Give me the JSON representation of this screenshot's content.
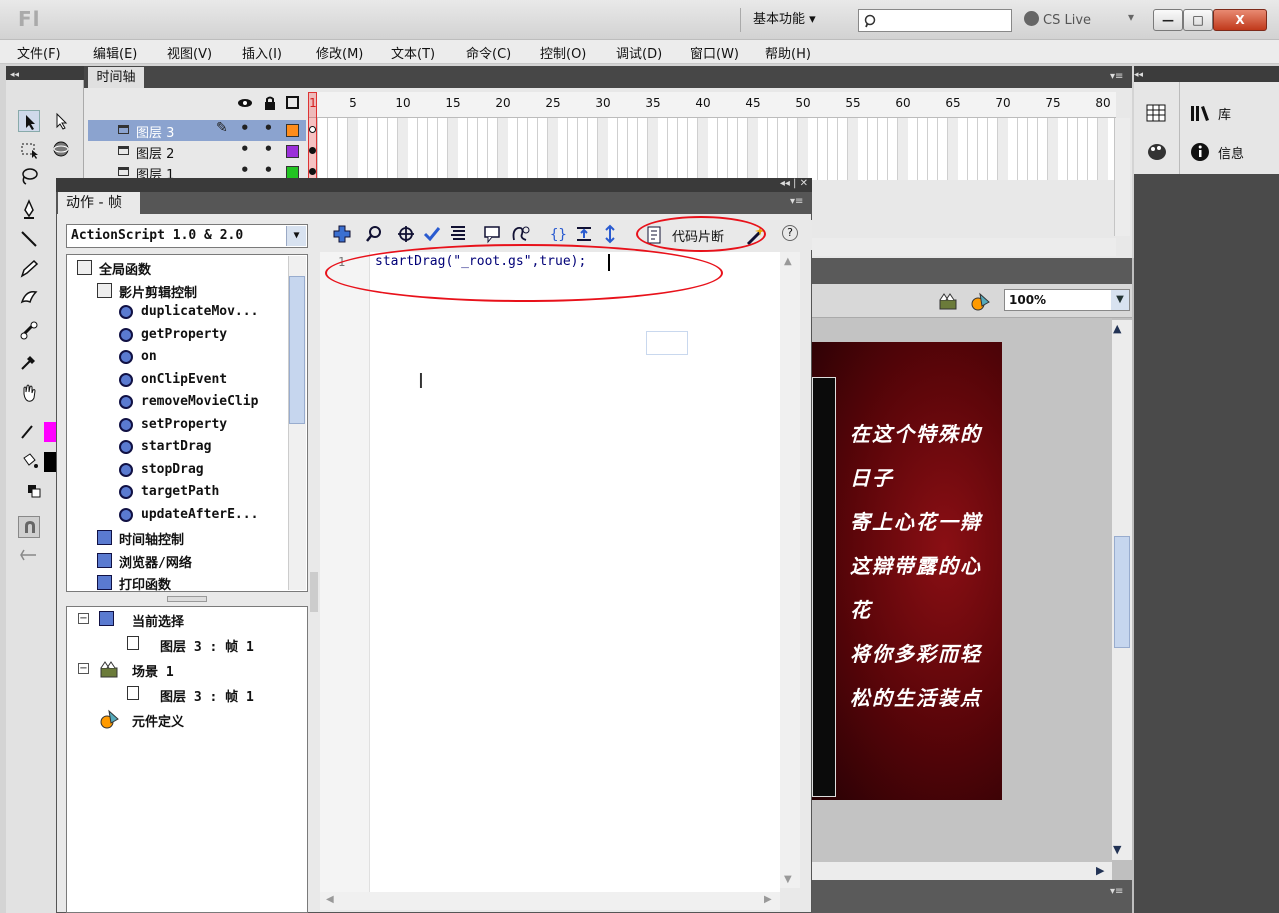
{
  "titlebar": {
    "app_logo": "Fl",
    "workspace": "基本功能 ▾",
    "search_placeholder": "",
    "cs_live": "CS Live",
    "dropdown_glyph": "▾",
    "minimize": "—",
    "maximize": "□",
    "close": "X"
  },
  "menubar": [
    "文件(F)",
    "编辑(E)",
    "视图(V)",
    "插入(I)",
    "修改(M)",
    "文本(T)",
    "命令(C)",
    "控制(O)",
    "调试(D)",
    "窗口(W)",
    "帮助(H)"
  ],
  "panel_collapse_glyph": "◂◂",
  "panel_menu_glyph": "▾≡",
  "timeline": {
    "tab": "时间轴",
    "ruler_numbers": [
      "1",
      "5",
      "10",
      "15",
      "20",
      "25",
      "30",
      "35",
      "40",
      "45",
      "50",
      "55",
      "60",
      "65",
      "70",
      "75",
      "80"
    ],
    "layers": [
      {
        "name": "图层 3",
        "color": "#ff8c1a",
        "selected": true
      },
      {
        "name": "图层 2",
        "color": "#9b30d9",
        "selected": false
      },
      {
        "name": "图层 1",
        "color": "#22c422",
        "selected": false
      }
    ]
  },
  "right_panel": {
    "library": "库",
    "info": "信息"
  },
  "stage": {
    "zoom": "100%",
    "poem": [
      "在这个特殊的",
      "日子",
      "寄上心花一辯",
      "这辯带露的心",
      "花",
      "将你多彩而轻",
      "松的生活装点"
    ]
  },
  "actions": {
    "tab": "动作 - 帧",
    "language": "ActionScript 1.0 & 2.0",
    "tree": [
      {
        "label": "全局函数",
        "kind": "book",
        "indent": 0
      },
      {
        "label": "影片剪辑控制",
        "kind": "book",
        "indent": 1
      },
      {
        "label": "duplicateMov...",
        "kind": "fn",
        "indent": 2
      },
      {
        "label": "getProperty",
        "kind": "fn",
        "indent": 2
      },
      {
        "label": "on",
        "kind": "fn",
        "indent": 2
      },
      {
        "label": "onClipEvent",
        "kind": "fn",
        "indent": 2
      },
      {
        "label": "removeMovieClip",
        "kind": "fn",
        "indent": 2
      },
      {
        "label": "setProperty",
        "kind": "fn",
        "indent": 2
      },
      {
        "label": "startDrag",
        "kind": "fn",
        "indent": 2
      },
      {
        "label": "stopDrag",
        "kind": "fn",
        "indent": 2
      },
      {
        "label": "targetPath",
        "kind": "fn",
        "indent": 2
      },
      {
        "label": "updateAfterE...",
        "kind": "fn",
        "indent": 2
      },
      {
        "label": "时间轴控制",
        "kind": "cat",
        "indent": 1
      },
      {
        "label": "浏览器/网络",
        "kind": "cat",
        "indent": 1
      },
      {
        "label": "打印函数",
        "kind": "cat",
        "indent": 1
      }
    ],
    "nav": {
      "current_selection": "当前选择",
      "current_frame": "图层 3 : 帧 1",
      "scene": "场景 1",
      "scene_frame": "图层 3 : 帧 1",
      "symbol_defs": "元件定义"
    },
    "snippets": "代码片断",
    "help": "?",
    "line_number": "1",
    "code": "startDrag(\"_root.gs\",true);"
  }
}
